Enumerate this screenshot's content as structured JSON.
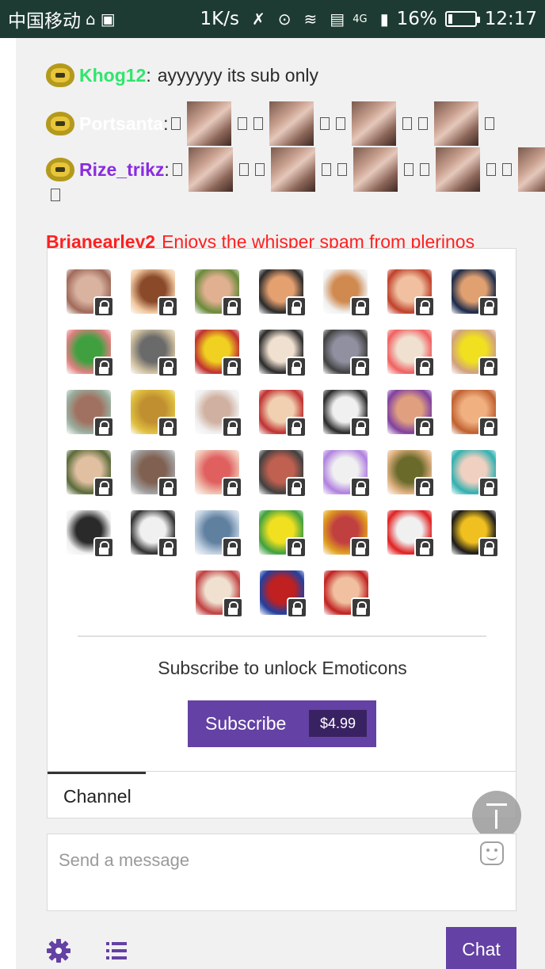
{
  "status_bar": {
    "carrier": "中国移动",
    "speed": "1K/s",
    "network": "4G",
    "battery_percent": "16%",
    "battery_level": 0.16,
    "time": "12:17"
  },
  "chat": {
    "messages": [
      {
        "user": "Khog12",
        "user_color": "#2ee66b",
        "separator": ":",
        "text": "ayyyyyy its sub only"
      },
      {
        "user": "Portsanta",
        "user_color": "#ffffff",
        "separator": ":"
      },
      {
        "user": "Rize_trikz",
        "user_color": "#8a2be2",
        "separator": ":"
      },
      {
        "user": "Brianearley2",
        "user_color": "#ff2020",
        "text": "Enjoys the whisper spam from plerinos"
      }
    ]
  },
  "emote_panel": {
    "emote_count": 38,
    "unlock_text": "Subscribe to unlock Emoticons",
    "subscribe_label": "Subscribe",
    "price": "$4.99",
    "accent_color": "#6441a4"
  },
  "tabs": {
    "channel_label": "Channel"
  },
  "input": {
    "placeholder": "Send a message"
  },
  "bottom_bar": {
    "chat_label": "Chat"
  },
  "icons": [
    "settings-gear-icon",
    "list-icon",
    "emoticon-smiley-icon",
    "scroll-to-top-icon",
    "lock-icon"
  ]
}
